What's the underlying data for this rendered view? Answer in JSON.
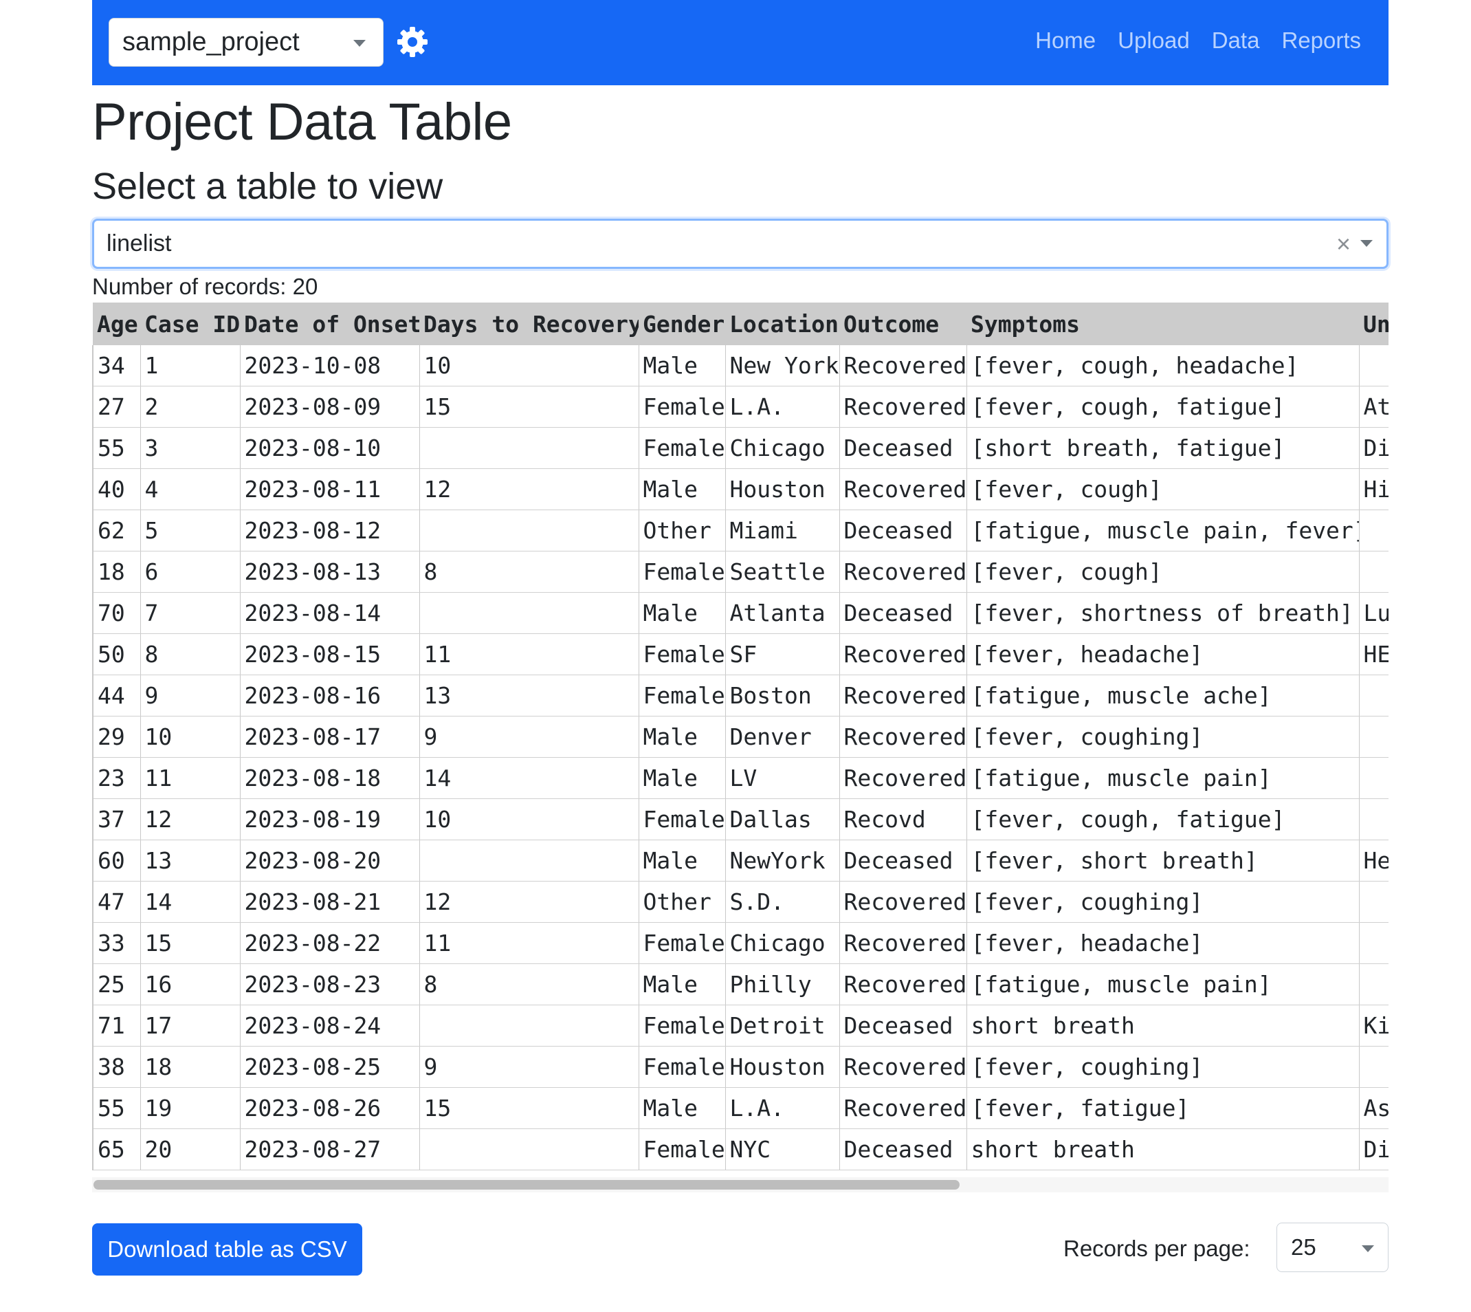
{
  "navbar": {
    "project": "sample_project",
    "links": [
      "Home",
      "Upload",
      "Data",
      "Reports"
    ]
  },
  "page": {
    "title": "Project Data Table",
    "subtitle": "Select a table to view",
    "table_select_value": "linelist",
    "records_label": "Number of records: 20"
  },
  "table": {
    "columns": [
      "Age",
      "Case ID",
      "Date of Onset",
      "Days to Recovery",
      "Gender",
      "Location",
      "Outcome",
      "Symptoms",
      "Underlying Conditions"
    ],
    "rows": [
      [
        "34",
        "1",
        "2023-10-08",
        "10",
        "Male",
        "New York",
        "Recovered",
        "[fever, cough, headache]",
        ""
      ],
      [
        "27",
        "2",
        "2023-08-09",
        "15",
        "Female",
        "L.A.",
        "Recovered",
        "[fever, cough, fatigue]",
        "At"
      ],
      [
        "55",
        "3",
        "2023-08-10",
        "",
        "Female",
        "Chicago",
        "Deceased",
        "[short breath, fatigue]",
        "Di"
      ],
      [
        "40",
        "4",
        "2023-08-11",
        "12",
        "Male",
        "Houston",
        "Recovered",
        "[fever, cough]",
        "Hi"
      ],
      [
        "62",
        "5",
        "2023-08-12",
        "",
        "Other",
        "Miami",
        "Deceased",
        "[fatigue, muscle pain, fever]",
        ""
      ],
      [
        "18",
        "6",
        "2023-08-13",
        "8",
        "Female",
        "Seattle",
        "Recovered",
        "[fever, cough]",
        ""
      ],
      [
        "70",
        "7",
        "2023-08-14",
        "",
        "Male",
        "Atlanta",
        "Deceased",
        "[fever, shortness of breath]",
        "Lu"
      ],
      [
        "50",
        "8",
        "2023-08-15",
        "11",
        "Female",
        "SF",
        "Recovered",
        "[fever, headache]",
        "HE"
      ],
      [
        "44",
        "9",
        "2023-08-16",
        "13",
        "Female",
        "Boston",
        "Recovered",
        "[fatigue, muscle ache]",
        ""
      ],
      [
        "29",
        "10",
        "2023-08-17",
        "9",
        "Male",
        "Denver",
        "Recovered",
        "[fever, coughing]",
        ""
      ],
      [
        "23",
        "11",
        "2023-08-18",
        "14",
        "Male",
        "LV",
        "Recovered",
        "[fatigue, muscle pain]",
        ""
      ],
      [
        "37",
        "12",
        "2023-08-19",
        "10",
        "Female",
        "Dallas",
        "Recovd",
        "[fever, cough, fatigue]",
        ""
      ],
      [
        "60",
        "13",
        "2023-08-20",
        "",
        "Male",
        "NewYork",
        "Deceased",
        "[fever, short breath]",
        "He"
      ],
      [
        "47",
        "14",
        "2023-08-21",
        "12",
        "Other",
        "S.D.",
        "Recovered",
        "[fever, coughing]",
        ""
      ],
      [
        "33",
        "15",
        "2023-08-22",
        "11",
        "Female",
        "Chicago",
        "Recovered",
        "[fever, headache]",
        ""
      ],
      [
        "25",
        "16",
        "2023-08-23",
        "8",
        "Male",
        "Philly",
        "Recovered",
        "[fatigue, muscle pain]",
        ""
      ],
      [
        "71",
        "17",
        "2023-08-24",
        "",
        "Female",
        "Detroit",
        "Deceased",
        "short breath",
        "Ki"
      ],
      [
        "38",
        "18",
        "2023-08-25",
        "9",
        "Female",
        "Houston",
        "Recovered",
        "[fever, coughing]",
        ""
      ],
      [
        "55",
        "19",
        "2023-08-26",
        "15",
        "Male",
        "L.A.",
        "Recovered",
        "[fever, fatigue]",
        "As"
      ],
      [
        "65",
        "20",
        "2023-08-27",
        "",
        "Female",
        "NYC",
        "Deceased",
        "short breath",
        "Di"
      ]
    ]
  },
  "footer": {
    "download_label": "Download table as CSV",
    "records_per_page_label": "Records per page:",
    "records_per_page_value": "25"
  },
  "icons": {
    "settings": "gear-icon",
    "dropdown": "chevron-down-icon",
    "clear": "close-icon"
  },
  "colors": {
    "navbar": "#1668f5",
    "nav_link": "#b9d3ff",
    "table_header": "#cccccc",
    "primary_button": "#1668f5",
    "focus_border": "#86b7fe"
  }
}
